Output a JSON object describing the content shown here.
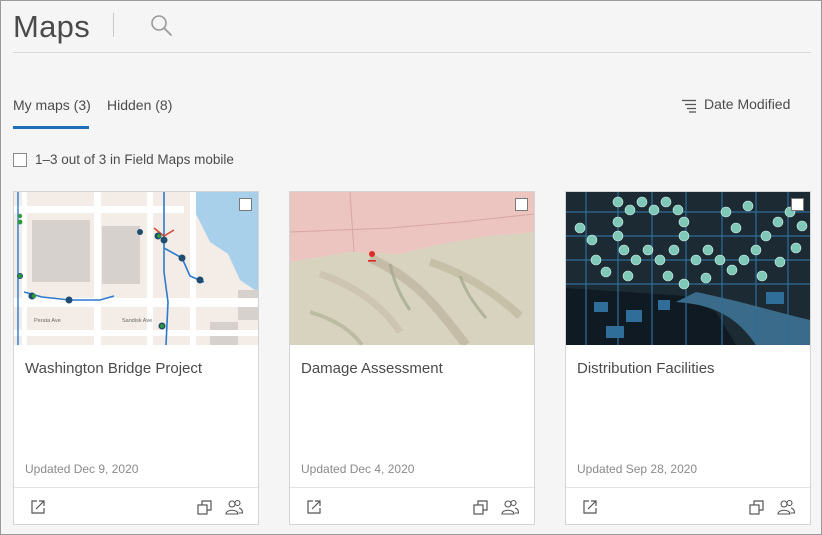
{
  "header": {
    "title": "Maps",
    "search_icon": "search-icon"
  },
  "tabs": [
    {
      "label": "My maps (3)",
      "active": true
    },
    {
      "label": "Hidden (8)",
      "active": false
    }
  ],
  "sort": {
    "label": "Date Modified",
    "icon": "sort-lines-icon"
  },
  "selection": {
    "label": "1–3 out of 3 in Field Maps mobile",
    "checked": false
  },
  "colors": {
    "accent": "#1d6fb8",
    "text": "#4c4c4c",
    "muted": "#8a8a8a",
    "background": "#f5f5f5"
  },
  "maps": [
    {
      "title": "Washington Bridge Project",
      "updated": "Updated Dec 9, 2020",
      "thumbnail": "street-map-with-pipeline",
      "street_labels": [
        "Perata Ave",
        "Sandisk Ave"
      ]
    },
    {
      "title": "Damage Assessment",
      "updated": "Updated Dec 4, 2020",
      "thumbnail": "terrain-map"
    },
    {
      "title": "Distribution Facilities",
      "updated": "Updated Sep 28, 2020",
      "thumbnail": "dark-map-with-facility-points"
    }
  ]
}
